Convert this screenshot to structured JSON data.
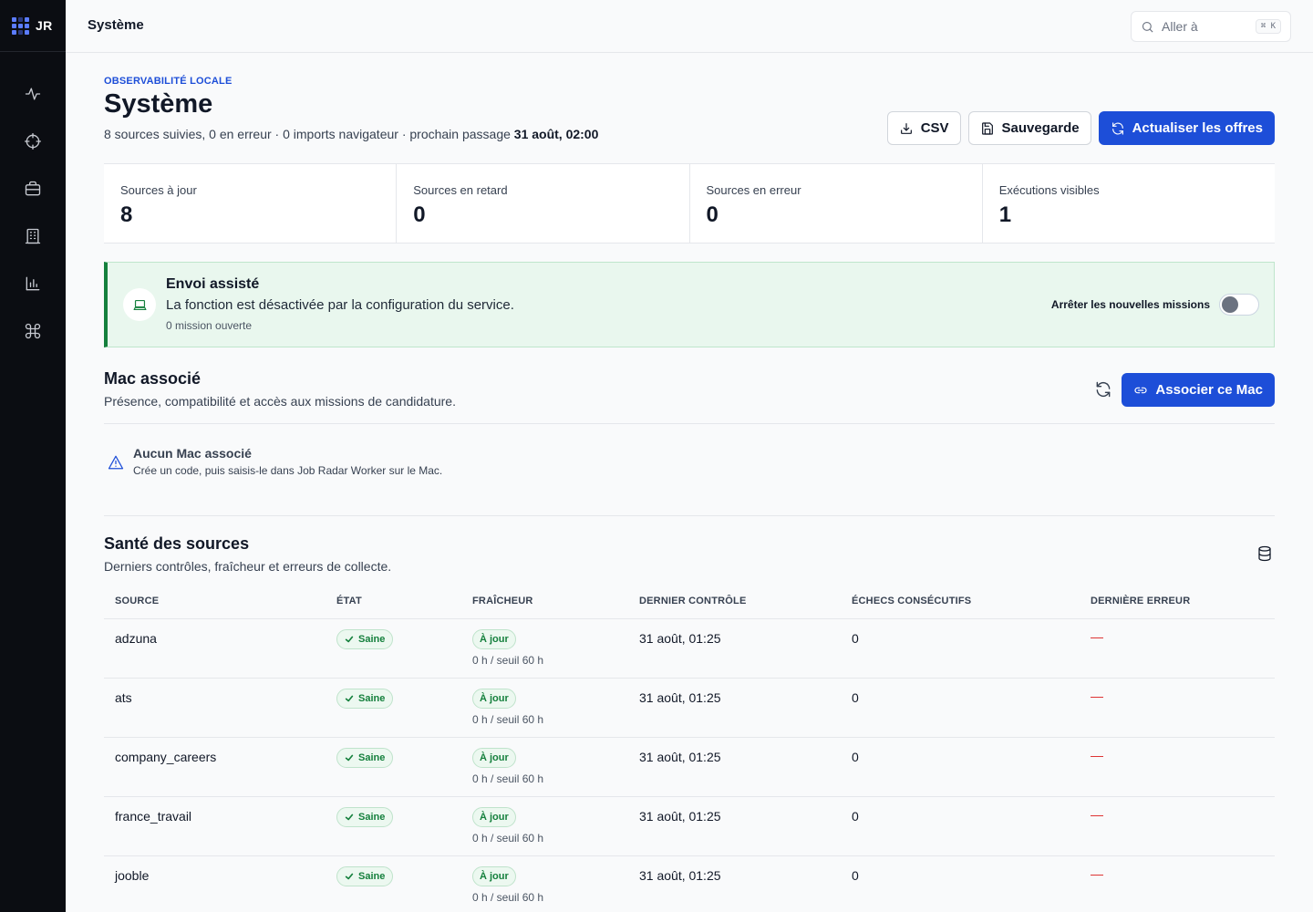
{
  "brand": {
    "logo_text": "JR"
  },
  "header": {
    "title": "Système",
    "search_placeholder": "Aller à",
    "search_shortcut": "⌘ K"
  },
  "sidebar": {
    "items": [
      {
        "name": "activity",
        "icon": "activity-icon"
      },
      {
        "name": "radar",
        "icon": "crosshair-icon"
      },
      {
        "name": "jobs",
        "icon": "briefcase-icon"
      },
      {
        "name": "companies",
        "icon": "building-icon"
      },
      {
        "name": "analytics",
        "icon": "bar-chart-icon"
      },
      {
        "name": "system",
        "icon": "command-icon"
      }
    ]
  },
  "page": {
    "eyebrow": "OBSERVABILITÉ LOCALE",
    "title": "Système",
    "subtitle": "8 sources suivies, 0 en erreur · 0 imports navigateur · prochain passage",
    "subtitle_strong": "31 août, 02:00",
    "actions": {
      "csv": "CSV",
      "backup": "Sauvegarde",
      "refresh": "Actualiser les offres"
    }
  },
  "stats": [
    {
      "label": "Sources à jour",
      "value": "8"
    },
    {
      "label": "Sources en retard",
      "value": "0"
    },
    {
      "label": "Sources en erreur",
      "value": "0"
    },
    {
      "label": "Exécutions visibles",
      "value": "1"
    }
  ],
  "assisted": {
    "title": "Envoi assisté",
    "text": "La fonction est désactivée par la configuration du service.",
    "meta": "0 mission ouverte",
    "toggle_label": "Arrêter les nouvelles missions",
    "toggle_on": false
  },
  "mac": {
    "title": "Mac associé",
    "subtitle": "Présence, compatibilité et accès aux missions de candidature.",
    "button": "Associer ce Mac",
    "empty_title": "Aucun Mac associé",
    "empty_text": "Crée un code, puis saisis-le dans Job Radar Worker sur le Mac."
  },
  "sources": {
    "title": "Santé des sources",
    "subtitle": "Derniers contrôles, fraîcheur et erreurs de collecte.",
    "columns": [
      "SOURCE",
      "ÉTAT",
      "FRAÎCHEUR",
      "DERNIER CONTRÔLE",
      "ÉCHECS CONSÉCUTIFS",
      "DERNIÈRE ERREUR"
    ],
    "rows": [
      {
        "source": "adzuna",
        "state": "Saine",
        "freshness": "À jour",
        "freshness_meta": "0 h / seuil 60 h",
        "last_check": "31 août, 01:25",
        "failures": "0",
        "last_error": "—"
      },
      {
        "source": "ats",
        "state": "Saine",
        "freshness": "À jour",
        "freshness_meta": "0 h / seuil 60 h",
        "last_check": "31 août, 01:25",
        "failures": "0",
        "last_error": "—"
      },
      {
        "source": "company_careers",
        "state": "Saine",
        "freshness": "À jour",
        "freshness_meta": "0 h / seuil 60 h",
        "last_check": "31 août, 01:25",
        "failures": "0",
        "last_error": "—"
      },
      {
        "source": "france_travail",
        "state": "Saine",
        "freshness": "À jour",
        "freshness_meta": "0 h / seuil 60 h",
        "last_check": "31 août, 01:25",
        "failures": "0",
        "last_error": "—"
      },
      {
        "source": "jooble",
        "state": "Saine",
        "freshness": "À jour",
        "freshness_meta": "0 h / seuil 60 h",
        "last_check": "31 août, 01:25",
        "failures": "0",
        "last_error": "—"
      }
    ]
  },
  "colors": {
    "accent": "#1d4ed8",
    "success": "#15803d",
    "success_bg": "#e9f7ee",
    "error": "#dc2626",
    "sidebar_bg": "#0b0d12"
  }
}
